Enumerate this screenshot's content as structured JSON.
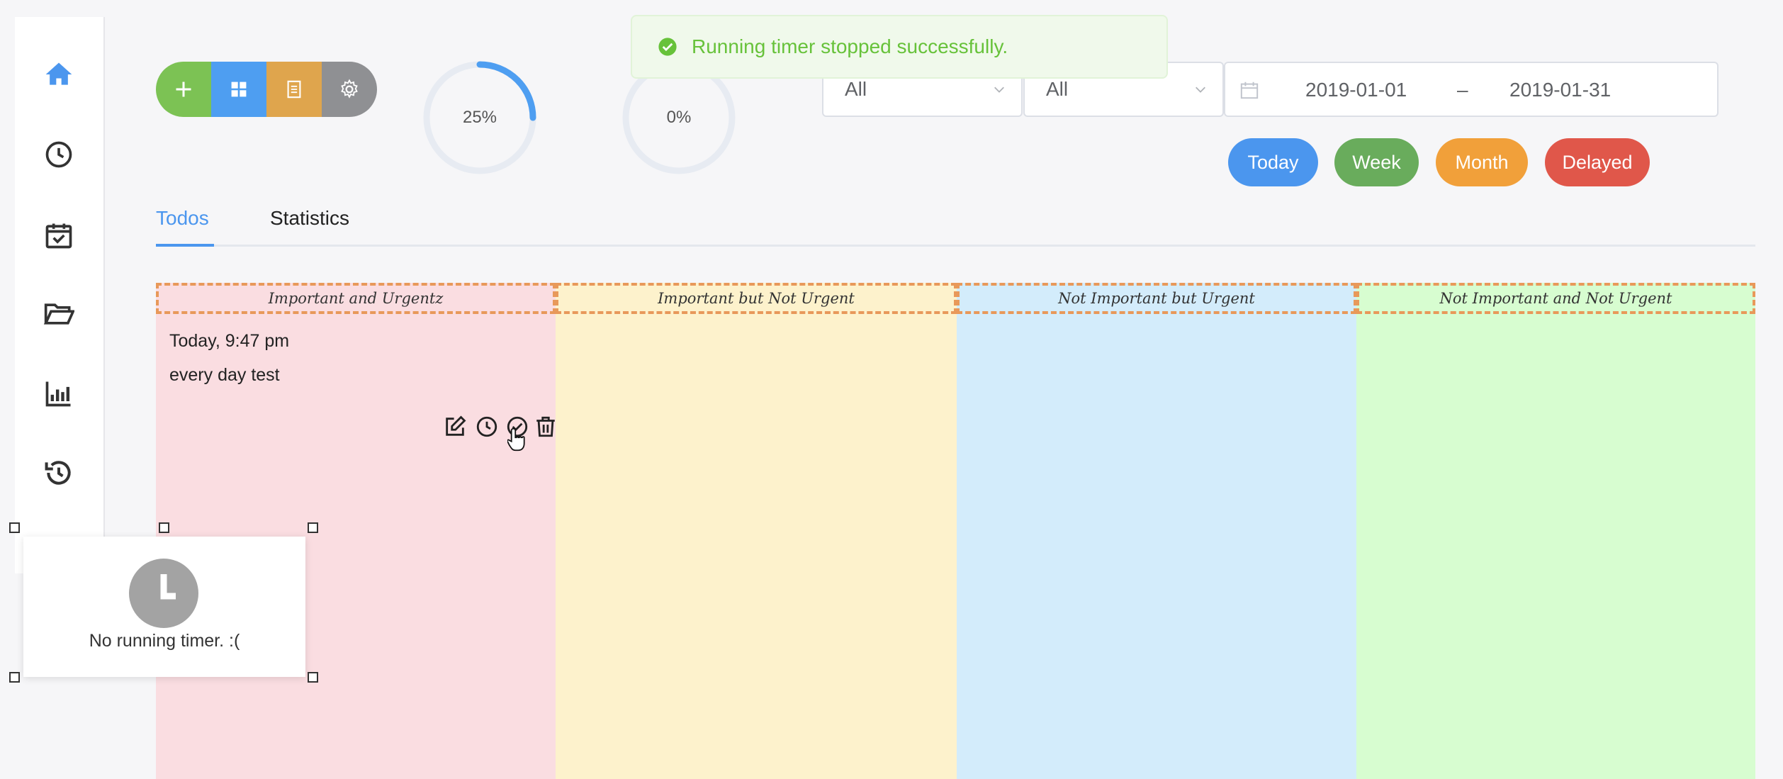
{
  "toast": {
    "message": "Running timer stopped successfully."
  },
  "toolbar": {
    "buttons": [
      {
        "icon": "plus-icon",
        "color": "#7cc254"
      },
      {
        "icon": "grid-icon",
        "color": "#4e9ef1"
      },
      {
        "icon": "document-icon",
        "color": "#dfa54d"
      },
      {
        "icon": "gear-icon",
        "color": "#8f9093"
      }
    ]
  },
  "progress": [
    {
      "label": "25%",
      "value": 0.25,
      "color": "#4e9ef1"
    },
    {
      "label": "0%",
      "value": 0,
      "color": "#4e9ef1"
    }
  ],
  "filters": {
    "select1": "All",
    "select2": "All",
    "date_start": "2019-01-01",
    "date_separator": "–",
    "date_end": "2019-01-31"
  },
  "quick_filters": [
    {
      "label": "Today",
      "color": "#4b96ee"
    },
    {
      "label": "Week",
      "color": "#69ac5c"
    },
    {
      "label": "Month",
      "color": "#f1a03a"
    },
    {
      "label": "Delayed",
      "color": "#e0574a"
    }
  ],
  "tabs": [
    {
      "label": "Todos",
      "active": true
    },
    {
      "label": "Statistics",
      "active": false
    }
  ],
  "quadrants": [
    {
      "title": "Important and Urgentz",
      "color": "#fadde1"
    },
    {
      "title": "Important but Not Urgent",
      "color": "#fdf2cc"
    },
    {
      "title": "Not Important but Urgent",
      "color": "#d3ecfb"
    },
    {
      "title": "Not Important and Not Urgent",
      "color": "#d7fdd0"
    }
  ],
  "todo": {
    "time": "Today, 9:47 pm",
    "title": "every day test"
  },
  "timer_popover": {
    "message": "No running timer. :("
  },
  "sidebar": {
    "icons": [
      "home-icon",
      "clock-icon",
      "calendar-check-icon",
      "folder-open-icon",
      "bar-chart-icon",
      "history-icon",
      "dot-icon"
    ]
  }
}
